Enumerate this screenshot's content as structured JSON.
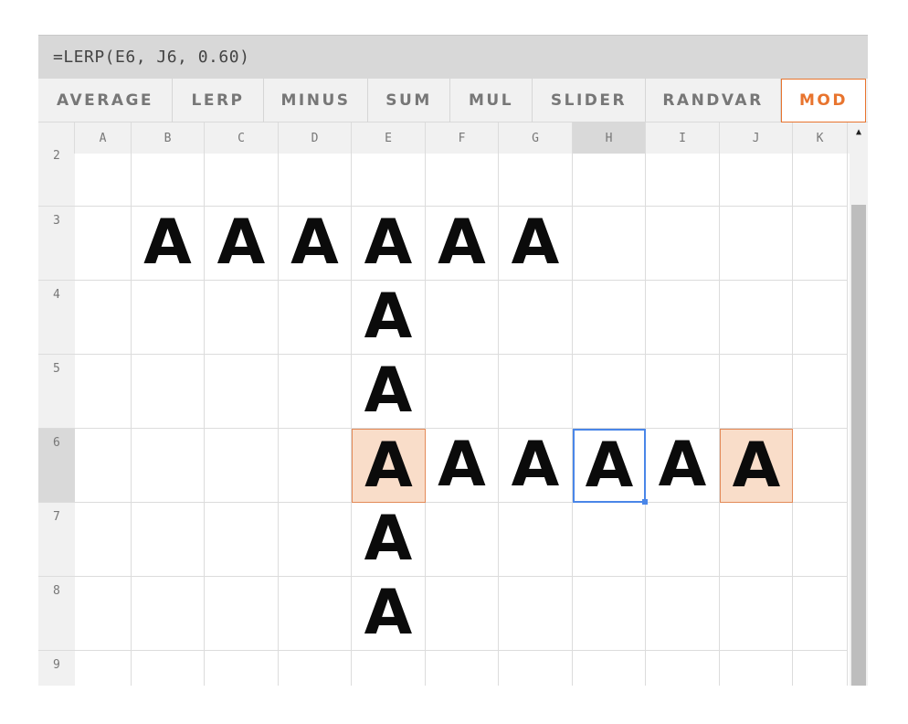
{
  "formula": "=LERP(E6, J6, 0.60)",
  "toolbar": [
    {
      "label": "AVERAGE",
      "active": false
    },
    {
      "label": "LERP",
      "active": false
    },
    {
      "label": "MINUS",
      "active": false
    },
    {
      "label": "SUM",
      "active": false
    },
    {
      "label": "MUL",
      "active": false
    },
    {
      "label": "SLIDER",
      "active": false
    },
    {
      "label": "RANDVAR",
      "active": false
    },
    {
      "label": "MOD",
      "active": true
    }
  ],
  "columns": [
    "A",
    "B",
    "C",
    "D",
    "E",
    "F",
    "G",
    "H",
    "I",
    "J",
    "K"
  ],
  "selected_column": "H",
  "rows": [
    "2",
    "3",
    "4",
    "5",
    "6",
    "7",
    "8",
    "9"
  ],
  "selected_row": "6",
  "glyph_char": "A",
  "cells": [
    {
      "ref": "B3",
      "value": "A"
    },
    {
      "ref": "C3",
      "value": "A"
    },
    {
      "ref": "D3",
      "value": "A"
    },
    {
      "ref": "E3",
      "value": "A"
    },
    {
      "ref": "F3",
      "value": "A"
    },
    {
      "ref": "G3",
      "value": "A"
    },
    {
      "ref": "E4",
      "value": "A"
    },
    {
      "ref": "E5",
      "value": "A"
    },
    {
      "ref": "E6",
      "value": "A",
      "highlight": "orange"
    },
    {
      "ref": "F6",
      "value": "A"
    },
    {
      "ref": "G6",
      "value": "A"
    },
    {
      "ref": "H6",
      "value": "A",
      "highlight": "blue"
    },
    {
      "ref": "I6",
      "value": "A"
    },
    {
      "ref": "J6",
      "value": "A",
      "highlight": "orange"
    },
    {
      "ref": "E7",
      "value": "A"
    },
    {
      "ref": "E8",
      "value": "A"
    }
  ],
  "colors": {
    "accent": "#e8742e",
    "highlight_fill": "#f9ddc9",
    "selection_border": "#4a86e8"
  },
  "icons": {
    "scroll_up": "triangle-up"
  }
}
